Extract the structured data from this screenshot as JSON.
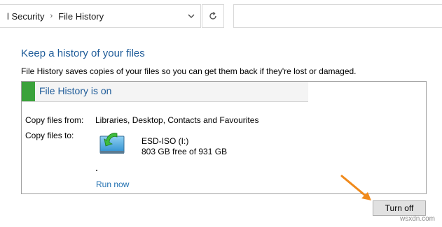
{
  "address_bar": {
    "crumbs": [
      "l Security",
      "File History"
    ],
    "separator": "›"
  },
  "content": {
    "heading": "Keep a history of your files",
    "description": "File History saves copies of your files so you can get them back if they're lost or damaged."
  },
  "status": {
    "title": "File History is on",
    "accent_color": "#3aa23a"
  },
  "copy_from": {
    "label": "Copy files from:",
    "value": "Libraries, Desktop, Contacts and Favourites"
  },
  "copy_to": {
    "label": "Copy files to:",
    "drive_name": "ESD-ISO (I:)",
    "drive_space": "803 GB free of 931 GB",
    "drive_icon": "drive-icon"
  },
  "actions": {
    "run_now": "Run now",
    "turn_off": "Turn off"
  },
  "annotation": {
    "arrow_color": "#f08a1c"
  },
  "watermark": "wsxdn.com"
}
